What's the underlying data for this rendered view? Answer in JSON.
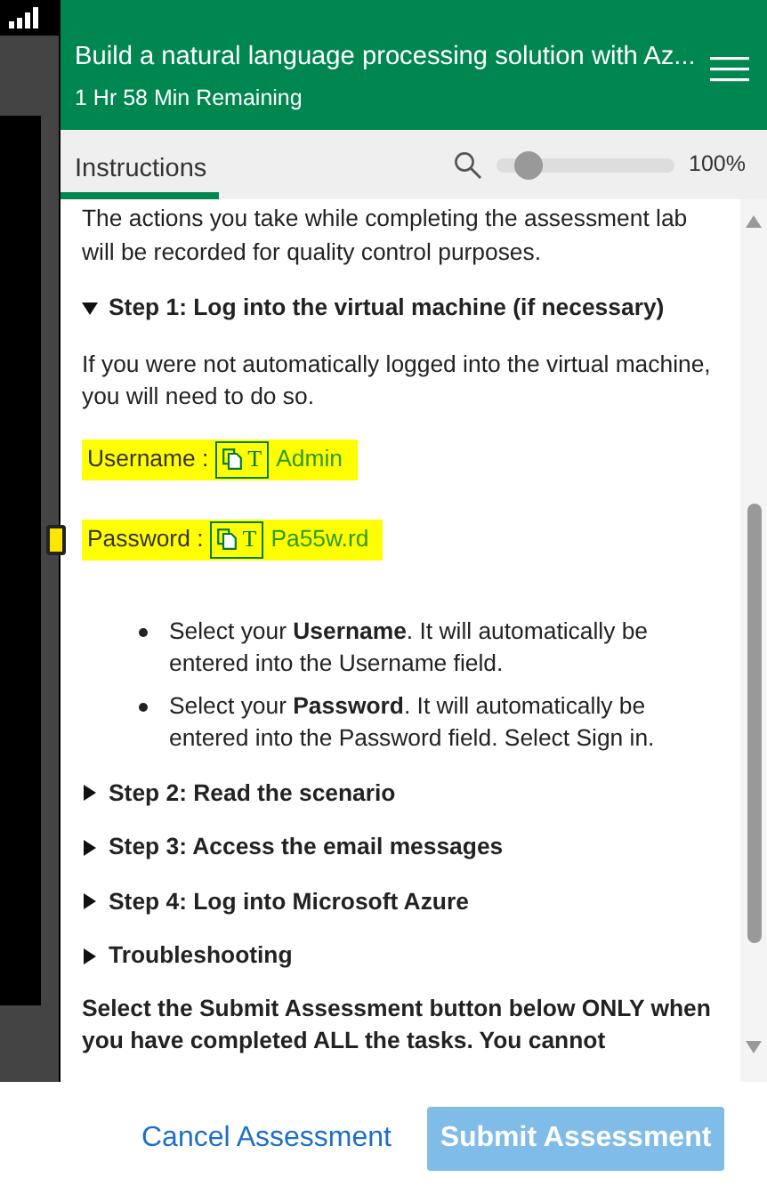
{
  "header": {
    "title": "Build a natural language processing solution with Az...",
    "time_remaining": "1 Hr 58 Min Remaining"
  },
  "tabs": [
    {
      "label": "Instructions",
      "selected": true
    }
  ],
  "zoom": {
    "level": 0.18,
    "reading": "100%"
  },
  "content": {
    "intro": "The actions you take while completing the assessment lab will be recorded for quality control purposes.",
    "sections": [
      {
        "title": "Step 1: Log into the virtual machine (if necessary)",
        "expanded": true,
        "text": "If you were not automatically logged into the virtual machine, you will need to do so.",
        "credentials": [
          {
            "label": "Username :",
            "copy_icon_text": "T",
            "value": "Admin"
          },
          {
            "label": "Password :",
            "copy_icon_text": "T",
            "value": "Pa55w.rd"
          }
        ],
        "bullets": [
          "Select your **Username**. It will automatically be entered into the Username field.",
          "Select your **Password**. It will automatically be entered into the Password field. Select Sign in."
        ]
      },
      {
        "title": "Step 2: Read the scenario",
        "expanded": false
      },
      {
        "title": "Step 3: Access the email messages",
        "expanded": false
      },
      {
        "title": "Step 4: Log into Microsoft Azure",
        "expanded": false
      },
      {
        "title": "Troubleshooting",
        "expanded": false
      }
    ],
    "notice": "Select the Submit Assessment button below ONLY when you have completed ALL the tasks. You cannot"
  },
  "footer": {
    "buttons": [
      {
        "label": "Cancel Assessment",
        "kind": "link",
        "disabled": false
      },
      {
        "label": "Submit Assessment",
        "kind": "primary",
        "disabled": true
      }
    ]
  }
}
